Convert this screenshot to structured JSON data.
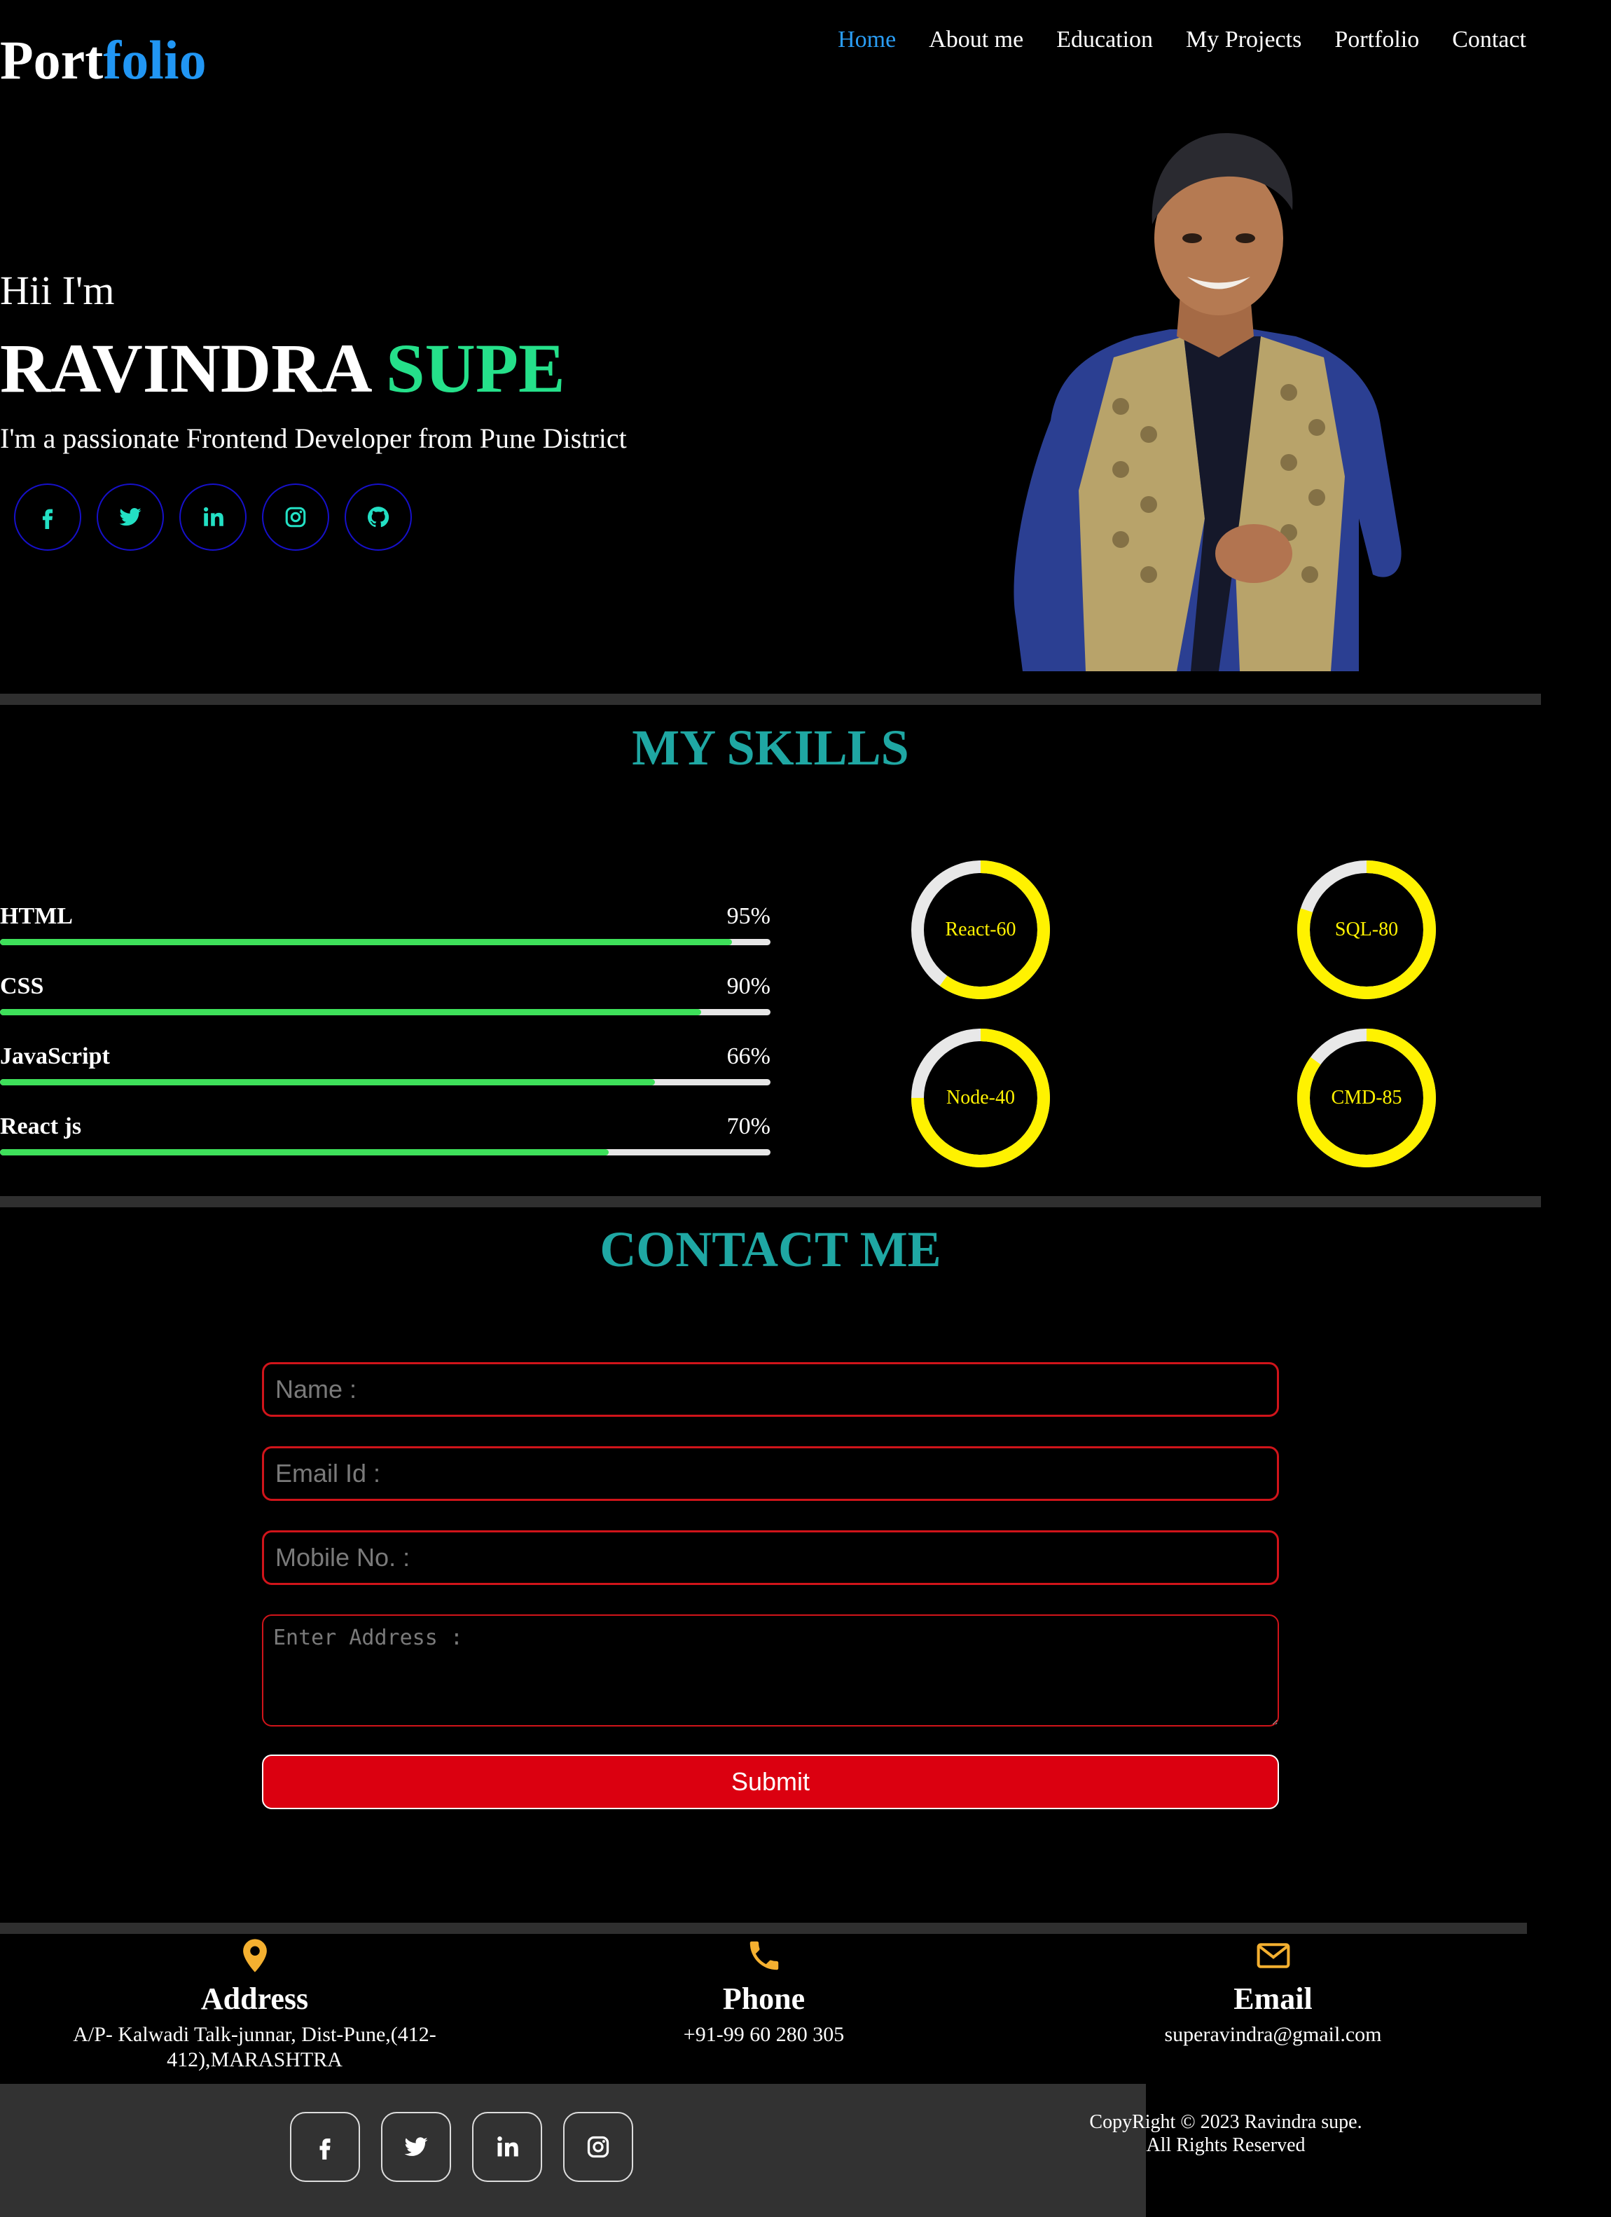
{
  "brand": {
    "logo_part1": "Port",
    "logo_part2": "folio"
  },
  "nav": {
    "items": [
      {
        "label": "Home",
        "active": true
      },
      {
        "label": "About me"
      },
      {
        "label": "Education"
      },
      {
        "label": "My Projects"
      },
      {
        "label": "Portfolio"
      },
      {
        "label": "Contact"
      }
    ]
  },
  "hero": {
    "greeting": "Hii I'm",
    "first_name": "RAVINDRA",
    "last_name": "SUPE",
    "tagline": "I'm a passionate Frontend Developer from Pune District",
    "socials": [
      "facebook-icon",
      "twitter-icon",
      "linkedin-icon",
      "instagram-icon",
      "github-icon"
    ]
  },
  "skills": {
    "title": "MY SKILLS",
    "bars": [
      {
        "name": "HTML",
        "percent_label": "95%",
        "fill": 0.95
      },
      {
        "name": "CSS",
        "percent_label": "90%",
        "fill": 0.91
      },
      {
        "name": "JavaScript",
        "percent_label": "66%",
        "fill": 0.85
      },
      {
        "name": "React js",
        "percent_label": "70%",
        "fill": 0.79
      }
    ],
    "circles": [
      {
        "label": "React-60",
        "fill": 0.6
      },
      {
        "label": "SQL-80",
        "fill": 0.8
      },
      {
        "label": "Node-40",
        "fill": 0.75
      },
      {
        "label": "CMD-85",
        "fill": 0.85
      }
    ]
  },
  "contact": {
    "title": "CONTACT ME",
    "name_placeholder": "Name :",
    "email_placeholder": "Email Id :",
    "mobile_placeholder": "Mobile No. :",
    "address_placeholder": "Enter Address :",
    "submit_label": "Submit"
  },
  "info": {
    "address": {
      "title": "Address",
      "text": "A/P- Kalwadi Talk-junnar, Dist-Pune,(412-412),MARASHTRA"
    },
    "phone": {
      "title": "Phone",
      "text": "+91-99 60 280 305"
    },
    "email": {
      "title": "Email",
      "text": "superavindra@gmail.com"
    }
  },
  "footer": {
    "socials": [
      "facebook-icon",
      "twitter-icon",
      "linkedin-icon",
      "instagram-icon"
    ],
    "copyright_line1": "CopyRight © 2023 Ravindra supe.",
    "copyright_line2": "All Rights Reserved"
  },
  "colors": {
    "accent_blue": "#2196f3",
    "accent_green": "#25e08a",
    "section_title_teal": "#1fa7a3",
    "skill_bar_green": "#3ee05a",
    "ring_yellow": "#fff200",
    "input_border_red": "#d0141a",
    "submit_red": "#db0010",
    "icon_orange": "#f4b030",
    "footer_gray": "#323232"
  }
}
